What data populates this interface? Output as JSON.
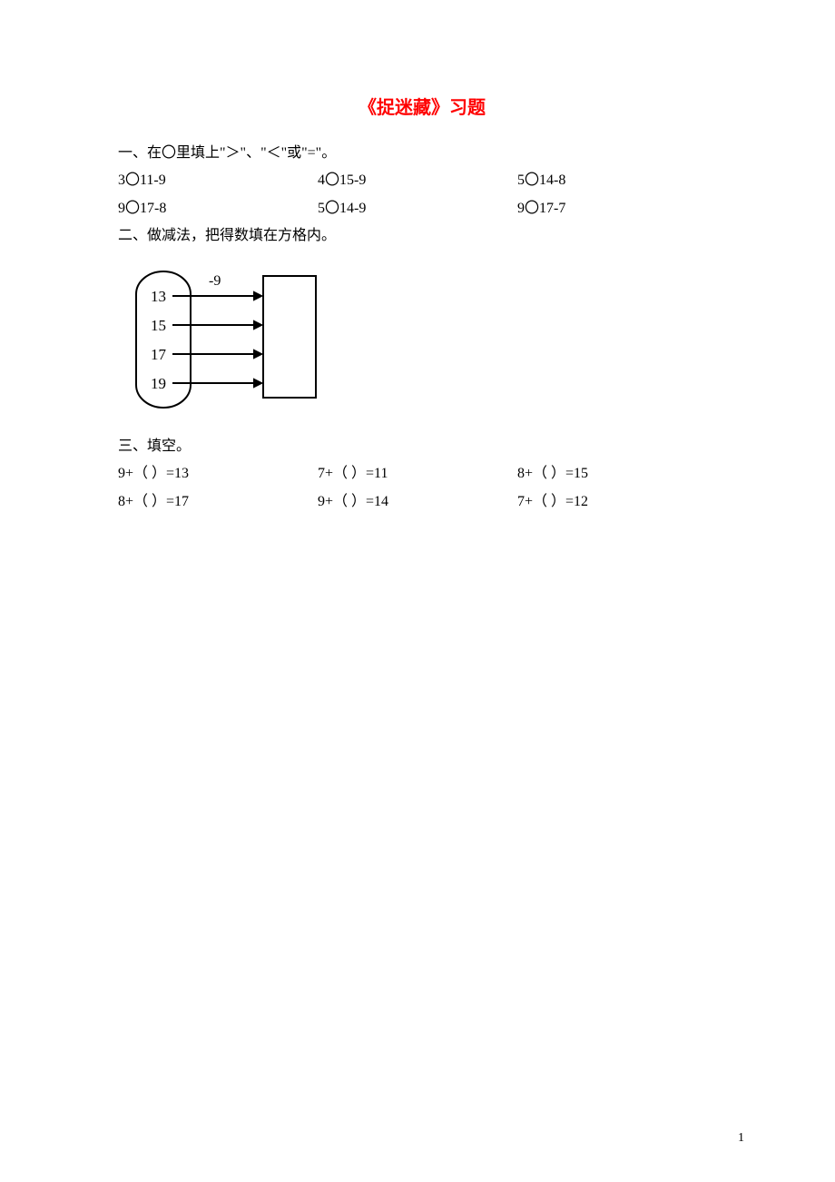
{
  "title": "《捉迷藏》习题",
  "section1": {
    "heading": "一、在〇里填上\"＞\"、\"＜\"或\"=\"。",
    "rows": [
      [
        "3〇11-9",
        "4〇15-9",
        "5〇14-8"
      ],
      [
        "9〇17-8",
        "5〇14-9",
        "9〇17-7"
      ]
    ]
  },
  "section2": {
    "heading": "二、做减法，把得数填在方格内。",
    "diagram": {
      "operation": "-9",
      "inputs": [
        "13",
        "15",
        "17",
        "19"
      ]
    }
  },
  "section3": {
    "heading": "三、填空。",
    "rows": [
      [
        "9+（  ）=13",
        "7+（  ）=11",
        "8+（  ）=15"
      ],
      [
        "8+（  ）=17",
        "9+（  ）=14",
        "7+（  ）=12"
      ]
    ]
  },
  "pagenum": "1"
}
